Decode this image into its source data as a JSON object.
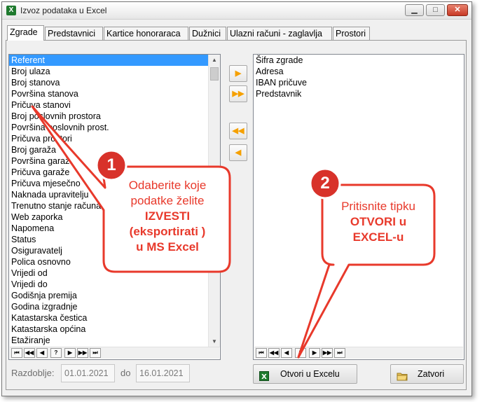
{
  "window": {
    "title": "Izvoz podataka u Excel",
    "app_icon": "excel-icon",
    "controls": {
      "minimize": "▁",
      "maximize": "□",
      "close": "✕"
    }
  },
  "tabs": [
    {
      "label": "Zgrade",
      "active": true
    },
    {
      "label": "Predstavnici",
      "active": false
    },
    {
      "label": "Kartice honoraraca",
      "active": false
    },
    {
      "label": "Dužnici",
      "active": false
    },
    {
      "label": "Ulazni računi - zaglavlja",
      "active": false
    },
    {
      "label": "Prostori",
      "active": false
    }
  ],
  "available_fields": {
    "selected_index": 0,
    "items": [
      "Referent",
      "Broj ulaza",
      "Broj stanova",
      "Površina stanova",
      "Pričuva stanovi",
      "Broj poslovnih prostora",
      "Površina poslovnih prost.",
      "Pričuva prostori",
      "Broj garaža",
      "Površina garaža",
      "Pričuva garaže",
      "Pričuva mjesečno",
      "Naknada upravitelju",
      "Trenutno stanje računa",
      "Web zaporka",
      "Napomena",
      "Status",
      "Osiguravatelj",
      "Polica osnovno",
      "Vrijedi od",
      "Vrijedi do",
      "Godišnja premija",
      "Godina izgradnje",
      "Katastarska čestica",
      "Katastarska općina",
      "Etažiranje"
    ]
  },
  "selected_fields": {
    "items": [
      "Šifra zgrade",
      "Adresa",
      "IBAN pričuve",
      "Predstavnik"
    ]
  },
  "nav_buttons": {
    "left": [
      "⏮",
      "◀◀",
      "◀",
      "?",
      "▶",
      "▶▶",
      "⏭"
    ],
    "right": [
      "⏮",
      "◀◀",
      "◀",
      "?",
      "▶",
      "▶▶",
      "⏭"
    ]
  },
  "move_buttons": {
    "add_one": "▶",
    "add_all": "▶▶",
    "remove_all": "◀◀",
    "remove_one": "◀"
  },
  "period": {
    "label": "Razdoblje:",
    "from": "01.01.2021",
    "to_label": "do",
    "to": "16.01.2021"
  },
  "buttons": {
    "open_excel": {
      "label": "Otvori u Excelu",
      "icon": "excel-icon"
    },
    "close": {
      "label": "Zatvori",
      "icon": "folder-icon"
    }
  },
  "callouts": [
    {
      "number": "1",
      "lines": [
        "Odaberite koje",
        "podatke želite"
      ],
      "bold_lines": [
        "IZVESTI",
        "(eksportirati )",
        "u MS Excel"
      ]
    },
    {
      "number": "2",
      "lines": [
        "Pritisnite tipku"
      ],
      "bold_lines": [
        "OTVORI u",
        "EXCEL-u"
      ]
    }
  ],
  "colors": {
    "selection": "#3399ff",
    "callout_red": "#e8392b",
    "badge_red": "#d8322a",
    "arrow_orange": "#f5a000"
  }
}
